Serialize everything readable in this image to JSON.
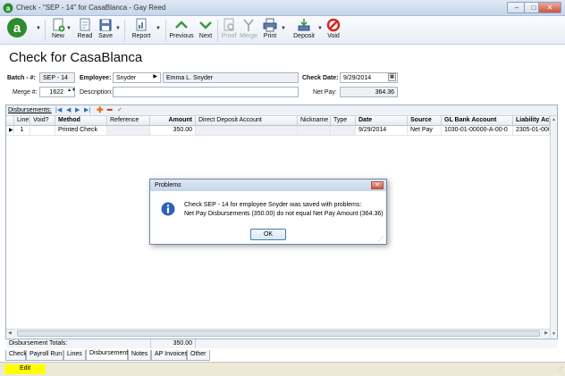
{
  "window": {
    "title": "Check - \"SEP - 14\" for CasaBlanca - Gay Reed"
  },
  "toolbar": {
    "new": "New",
    "read": "Read",
    "save": "Save",
    "report": "Report",
    "previous": "Previous",
    "next": "Next",
    "proof": "Proof",
    "merge": "Merge",
    "print": "Print",
    "deposit": "Deposit",
    "void": "Void"
  },
  "page": {
    "heading": "Check for CasaBlanca"
  },
  "form": {
    "batch_label": "Batch - #:",
    "batch_value": "SEP - 14",
    "employee_label": "Employee:",
    "employee_id": "Snyder",
    "employee_name": "Emma L. Snyder",
    "check_date_label": "Check Date:",
    "check_date_value": "9/29/2014",
    "merge_label": "Merge #:",
    "merge_value": "1622",
    "description_label": "Description:",
    "description_value": "",
    "net_pay_label": "Net Pay:",
    "net_pay_value": "364.36"
  },
  "grid": {
    "disbursements_label": "Disbursements:",
    "columns": [
      "Line",
      "Void?",
      "Method",
      "Reference",
      "Amount",
      "Direct Deposit Account",
      "Nickname",
      "Type",
      "Date",
      "Source",
      "GL Bank Account",
      "Liability Ac"
    ],
    "rows": [
      {
        "line": "1",
        "void": "",
        "method": "Printed Check",
        "reference": "",
        "amount": "350.00",
        "dda": "",
        "nickname": "",
        "type": "",
        "date": "9/29/2014",
        "source": "Net Pay",
        "gl_bank": "1030-01-00000-A-00-0",
        "liability": "2305-01-000"
      }
    ],
    "totals_label": "Disbursement Totals:",
    "totals_amount": "350.00"
  },
  "tabs": [
    "Check",
    "Payroll Run",
    "Lines",
    "Disbursement",
    "Notes",
    "AP Invoices",
    "Other"
  ],
  "status": {
    "mode": "Edit"
  },
  "dialog": {
    "title": "Problems",
    "line1": "Check SEP - 14 for employee Snyder was saved with problems:",
    "line2": "Net Pay Disbursements (350.00) do not equal Net Pay Amount (364.36)",
    "ok": "OK"
  },
  "colors": {
    "toolbar_green": "#3a9a3a",
    "void_red": "#d9261c",
    "status_yellow": "#ffff00",
    "logo_green": "#2e8b2e"
  }
}
